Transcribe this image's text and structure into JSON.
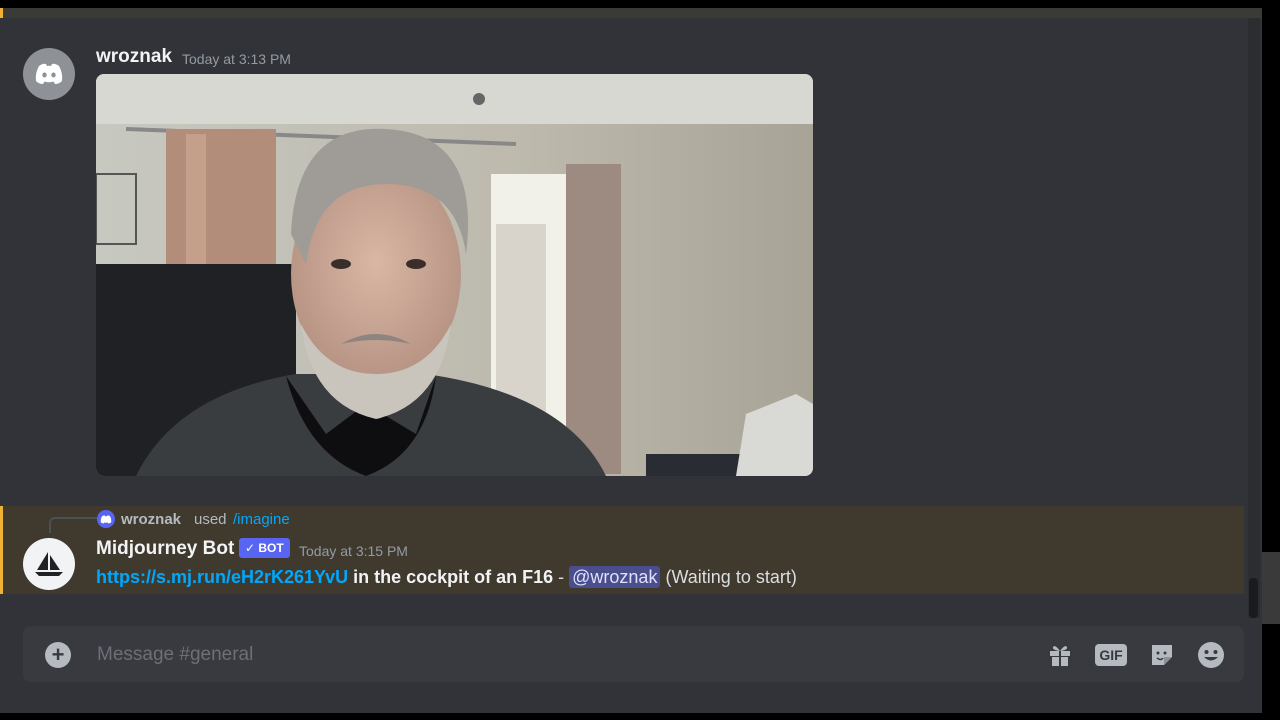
{
  "channel": {
    "name": "general"
  },
  "messages": [
    {
      "author": "wroznak",
      "timestamp": "Today at 3:13 PM",
      "attachment": "photo"
    },
    {
      "reply": {
        "user": "wroznak",
        "verb": "used",
        "command": "/imagine"
      },
      "author": "Midjourney Bot",
      "badge": "✓ BOT",
      "timestamp": "Today at 3:15 PM",
      "link": "https://s.mj.run/eH2rK261YvU",
      "prompt": "in the cockpit of an F16",
      "separator": " - ",
      "mention": "@wroznak",
      "status": "(Waiting to start)"
    }
  ],
  "composer": {
    "placeholder": "Message #general",
    "icons": [
      "plus-icon",
      "gift-icon",
      "gif-icon",
      "sticker-icon",
      "emoji-icon"
    ],
    "gif_label": "GIF"
  },
  "colors": {
    "background": "#313338",
    "highlight": "#40392e",
    "mention_bar": "#f0b232",
    "link": "#00a8fc",
    "bot_badge": "#5865f2"
  }
}
